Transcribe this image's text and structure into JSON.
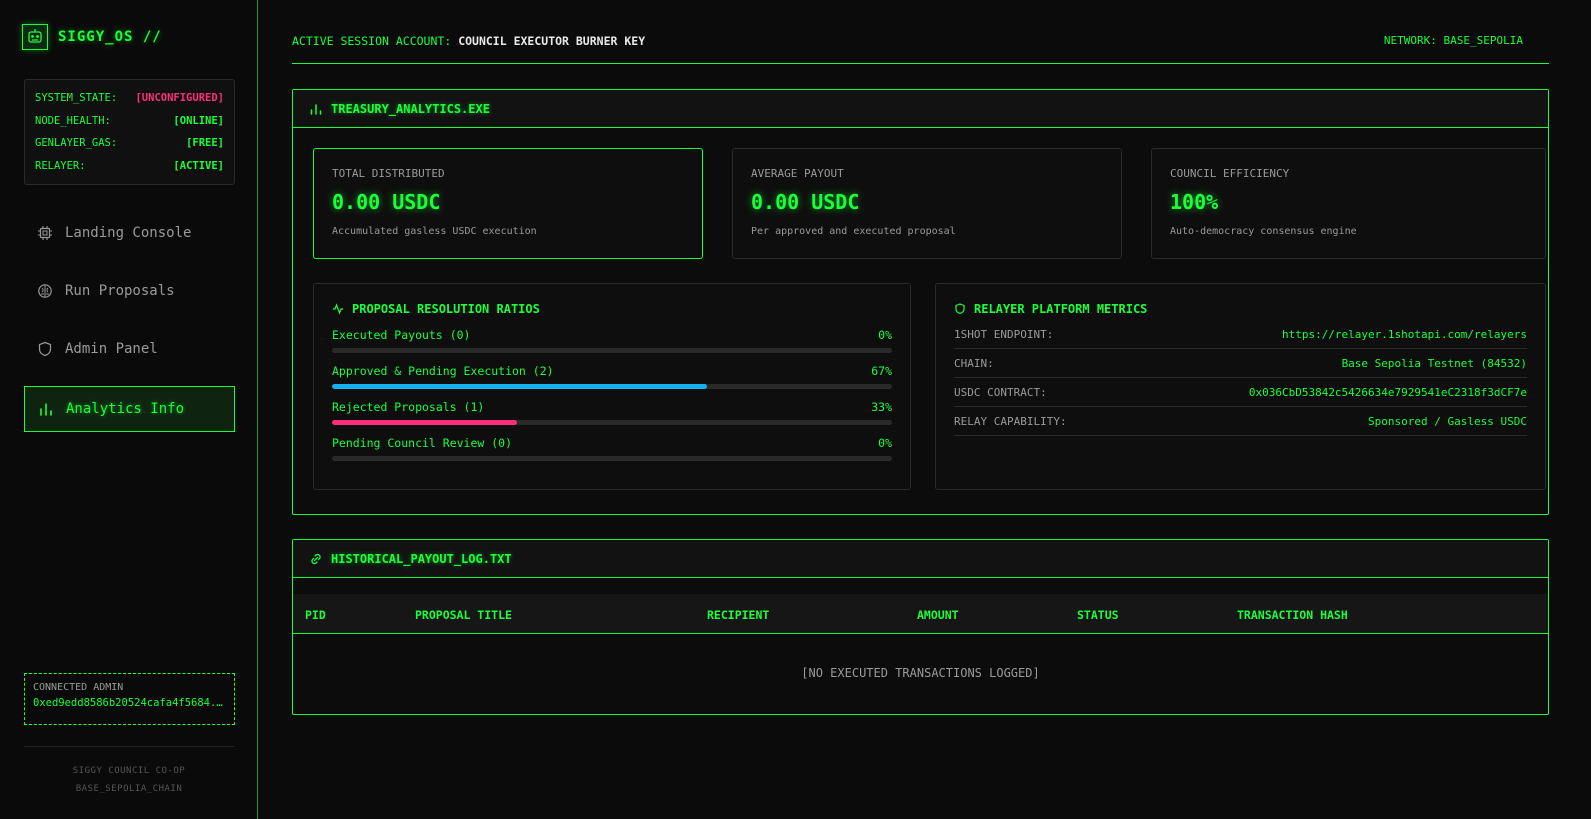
{
  "brand": {
    "title": "SIGGY_OS //"
  },
  "system_status": [
    {
      "key": "SYSTEM_STATE:",
      "value": "[UNCONFIGURED]",
      "color": "#ff2d7a"
    },
    {
      "key": "NODE_HEALTH:",
      "value": "[ONLINE]",
      "color": "#1aff3a"
    },
    {
      "key": "GENLAYER_GAS:",
      "value": "[FREE]",
      "color": "#1aff3a"
    },
    {
      "key": "RELAYER:",
      "value": "[ACTIVE]",
      "color": "#1aff3a"
    }
  ],
  "nav": [
    {
      "label": "Landing Console",
      "icon": "chip-icon"
    },
    {
      "label": "Run Proposals",
      "icon": "brain-icon"
    },
    {
      "label": "Admin Panel",
      "icon": "shield-icon"
    },
    {
      "label": "Analytics Info",
      "icon": "bar-chart-icon",
      "active": true
    }
  ],
  "admin": {
    "label": "CONNECTED ADMIN",
    "address": "0xed9edd8586b20524cafa4f5684..."
  },
  "footer": {
    "line1": "SIGGY COUNCIL CO-OP",
    "line2": "BASE_SEPOLIA_CHAIN"
  },
  "topbar": {
    "session_label": "ACTIVE SESSION ACCOUNT:",
    "session_value": "COUNCIL EXECUTOR BURNER KEY",
    "network": "NETWORK: BASE_SEPOLIA"
  },
  "treasury": {
    "title": "TREASURY_ANALYTICS.EXE",
    "stats": [
      {
        "label": "TOTAL DISTRIBUTED",
        "value": "0.00 USDC",
        "sub": "Accumulated gasless USDC execution"
      },
      {
        "label": "AVERAGE PAYOUT",
        "value": "0.00 USDC",
        "sub": "Per approved and executed proposal"
      },
      {
        "label": "COUNCIL EFFICIENCY",
        "value": "100%",
        "sub": "Auto-democracy consensus engine"
      }
    ],
    "ratios_title": "PROPOSAL RESOLUTION RATIOS",
    "ratios": [
      {
        "label": "Executed Payouts (0)",
        "pct_label": "0%",
        "fraction": 0,
        "color": "#1aff3a"
      },
      {
        "label": "Approved & Pending Execution (2)",
        "pct_label": "67%",
        "fraction": 0.67,
        "color": "#12b3f0"
      },
      {
        "label": "Rejected Proposals (1)",
        "pct_label": "33%",
        "fraction": 0.33,
        "color": "#ff2d7a"
      },
      {
        "label": "Pending Council Review (0)",
        "pct_label": "0%",
        "fraction": 0,
        "color": "#ffd21a"
      }
    ],
    "relayer_title": "RELAYER PLATFORM METRICS",
    "relayer_metrics": [
      {
        "key": "1SHOT ENDPOINT:",
        "value": "https://relayer.1shotapi.com/relayers"
      },
      {
        "key": "CHAIN:",
        "value": "Base Sepolia Testnet (84532)"
      },
      {
        "key": "USDC CONTRACT:",
        "value": "0x036CbD53842c5426634e7929541eC2318f3dCF7e"
      },
      {
        "key": "RELAY CAPABILITY:",
        "value": "Sponsored / Gasless USDC"
      }
    ]
  },
  "payout_log": {
    "title": "HISTORICAL_PAYOUT_LOG.TXT",
    "columns": [
      "PID",
      "PROPOSAL TITLE",
      "RECIPIENT",
      "AMOUNT",
      "STATUS",
      "TRANSACTION HASH"
    ],
    "empty_message": "[NO EXECUTED TRANSACTIONS LOGGED]"
  }
}
